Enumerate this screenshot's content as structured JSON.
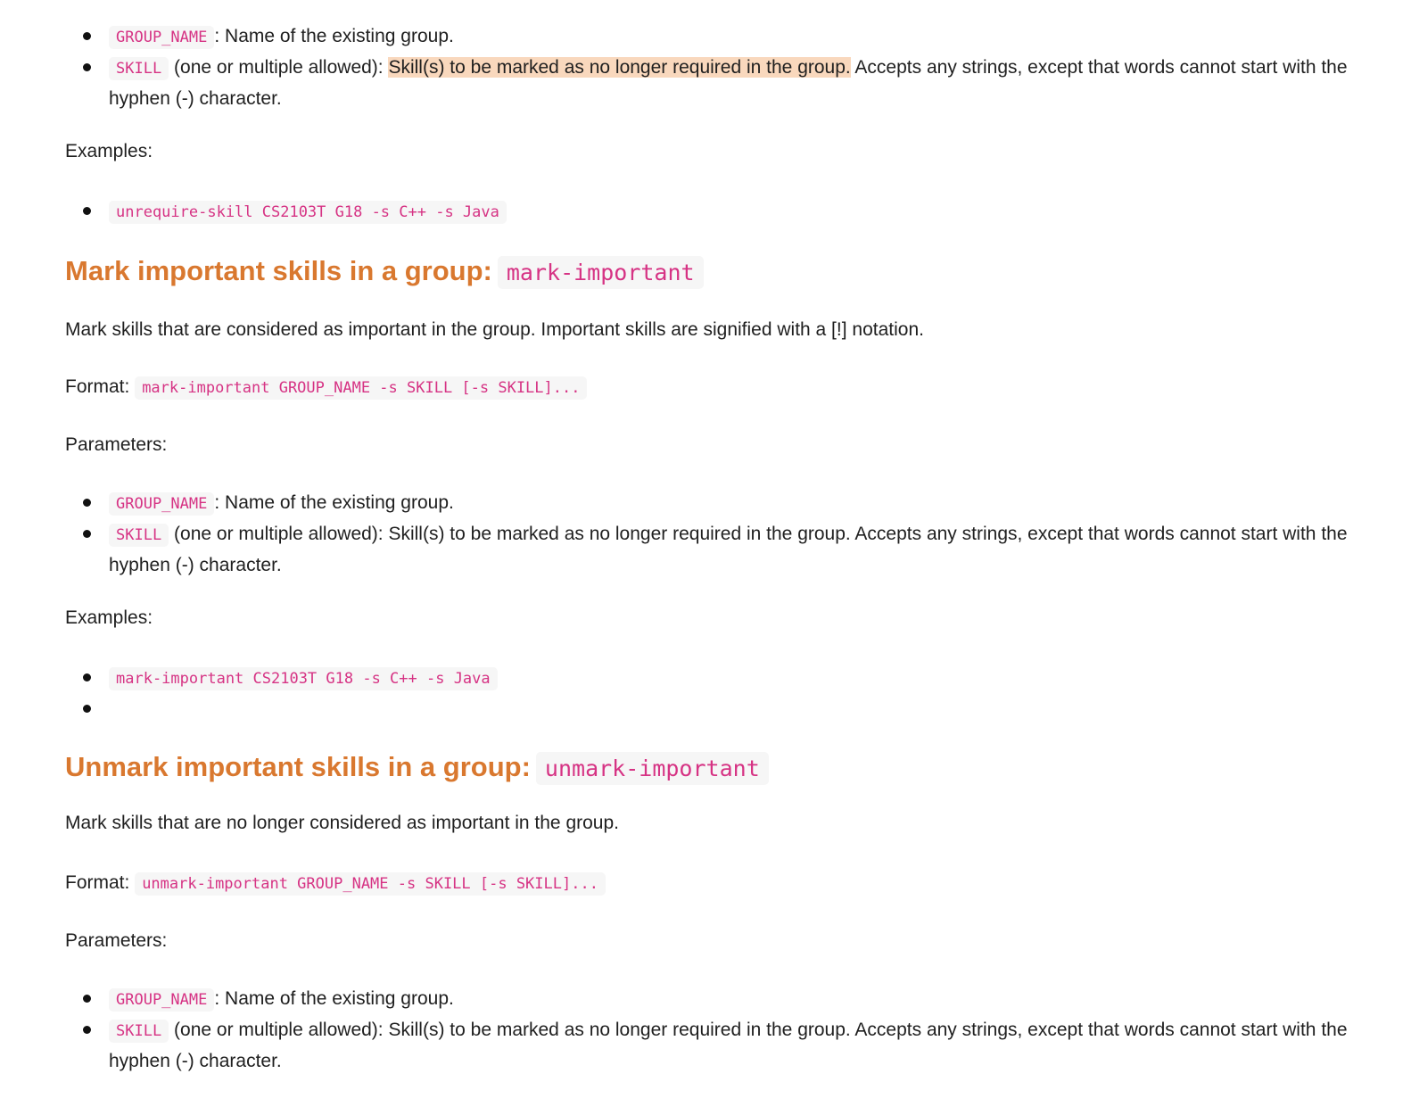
{
  "unrequire": {
    "params": [
      {
        "code": "GROUP_NAME",
        "text": ": Name of the existing group."
      },
      {
        "code": "SKILL",
        "text_pre": " (one or multiple allowed): ",
        "highlight": "Skill(s) to be marked as no longer required in the group.",
        "text_post": " Accepts any strings, except that words cannot start with the hyphen (-) character."
      }
    ],
    "examples_label": "Examples:",
    "example": "unrequire-skill CS2103T G18 -s C++ -s Java"
  },
  "mark_important": {
    "heading": "Mark important skills in a group:",
    "heading_code": "mark-important",
    "description": "Mark skills that are considered as important in the group. Important skills are signified with a [!] notation.",
    "format_label": "Format:",
    "format_code": "mark-important GROUP_NAME -s SKILL [-s SKILL]...",
    "parameters_label": "Parameters:",
    "params": [
      {
        "code": "GROUP_NAME",
        "text": ": Name of the existing group."
      },
      {
        "code": "SKILL",
        "text": " (one or multiple allowed): Skill(s) to be marked as no longer required in the group. Accepts any strings, except that words cannot start with the hyphen (-) character."
      }
    ],
    "examples_label": "Examples:",
    "example": "mark-important CS2103T G18 -s C++ -s Java"
  },
  "unmark_important": {
    "heading": "Unmark important skills in a group:",
    "heading_code": "unmark-important",
    "description": "Mark skills that are no longer considered as important in the group.",
    "format_label": "Format:",
    "format_code": "unmark-important GROUP_NAME -s SKILL [-s SKILL]...",
    "parameters_label": "Parameters:",
    "params": [
      {
        "code": "GROUP_NAME",
        "text": ": Name of the existing group."
      },
      {
        "code": "SKILL",
        "text": " (one or multiple allowed): Skill(s) to be marked as no longer required in the group. Accepts any strings, except that words cannot start with the hyphen (-) character."
      }
    ]
  },
  "colors": {
    "heading": "#d9782f",
    "code_text": "#d63384",
    "code_bg": "#f6f6f6",
    "highlight": "#f9d8bd"
  }
}
